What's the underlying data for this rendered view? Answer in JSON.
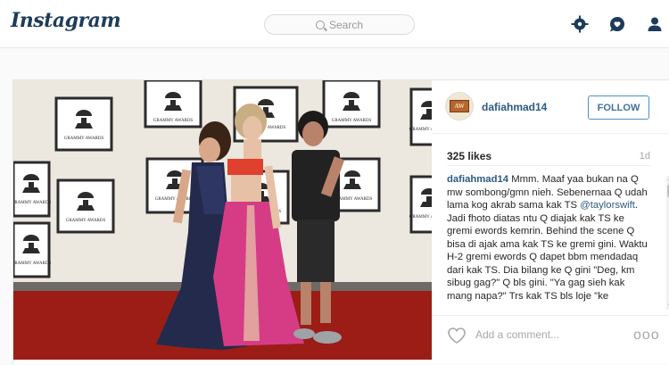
{
  "header": {
    "logo": "Instagram",
    "search_placeholder": "Search"
  },
  "post": {
    "username": "dafiahmad14",
    "follow_label": "FOLLOW",
    "likes": "325 likes",
    "time": "1d",
    "avatar_text": "AW",
    "caption": {
      "author": "dafiahmad14",
      "text_before_mention": " Mmm. Maaf yaa bukan na Q mw sombong/gmn nieh. Sebenernaa Q udah lama kog akrab sama kak TS ",
      "mention": "@taylorswift",
      "text_after_mention": ". Jadi fhoto diatas ntu Q diajak kak TS ke gremi ewords kemrin. Behind the scene Q bisa di ajak ama kak TS ke gremi gini. Waktu H-2 gremi ewords Q dapet bbm mendadaq dari kak TS. Dia bilang ke Q gini \"Deg, km sibug gag?\" Q bls gini. \"Ya gag sieh kak mang napa?\" Trs kak TS bls loje \"ke"
    },
    "comment_placeholder": "Add a comment...",
    "more_label": "ooo",
    "photo_backdrop_text": "GRAMMY AWARDS"
  },
  "colors": {
    "link": "#2a5a82",
    "follow_border": "#4d8fc7",
    "nav_icon": "#1d3c5b"
  },
  "icons": [
    "search-icon",
    "explore-compass-icon",
    "activity-icon",
    "profile-icon",
    "heart-icon"
  ]
}
